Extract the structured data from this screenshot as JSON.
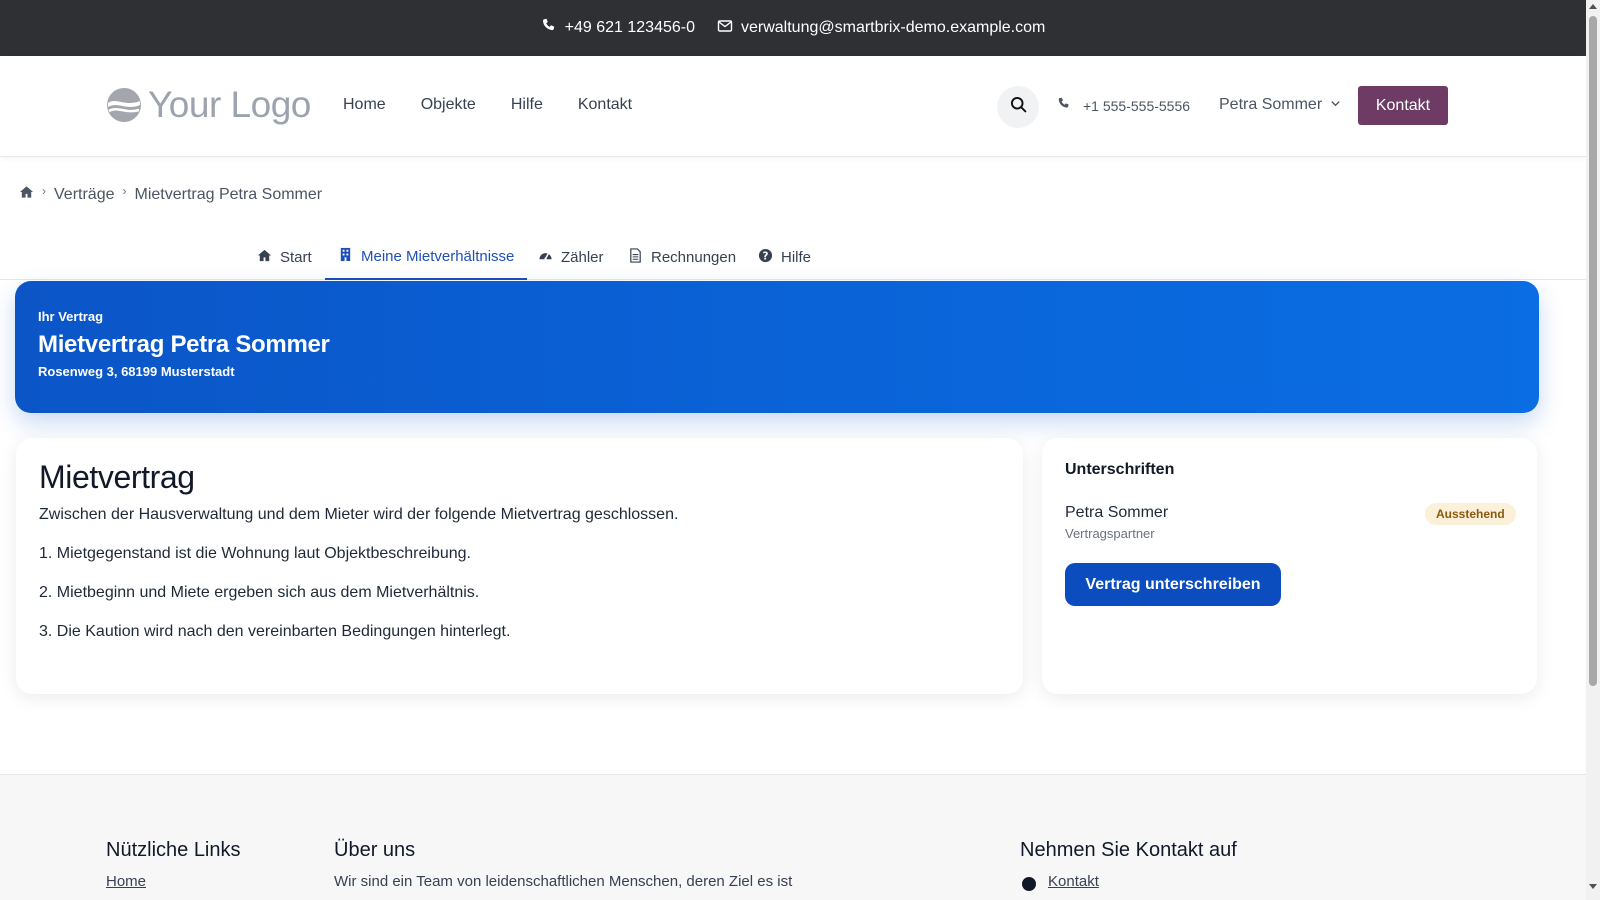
{
  "topbar": {
    "phone": "+49 621 123456-0",
    "email": "verwaltung@smartbrix-demo.example.com",
    "phone_icon": "phone-icon",
    "email_icon": "mail-icon"
  },
  "header": {
    "logo_text": "Your Logo",
    "nav": [
      "Home",
      "Objekte",
      "Hilfe",
      "Kontakt"
    ],
    "search_icon": "search-icon",
    "phone": "+1 555-555-5556",
    "user_name": "Petra Sommer",
    "cta_label": "Kontakt",
    "cta_color": "#6d3b64"
  },
  "breadcrumb": {
    "home_icon": "home-icon",
    "items": [
      "Verträge",
      "Mietvertrag Petra Sommer"
    ]
  },
  "tabs": [
    {
      "label": "Start",
      "icon": "home-icon",
      "active": false
    },
    {
      "label": "Meine Mietverhältnisse",
      "icon": "building-icon",
      "active": true
    },
    {
      "label": "Zähler",
      "icon": "gauge-icon",
      "active": false
    },
    {
      "label": "Rechnungen",
      "icon": "document-icon",
      "active": false
    },
    {
      "label": "Hilfe",
      "icon": "question-icon",
      "active": false
    }
  ],
  "hero": {
    "kicker": "Ihr Vertrag",
    "title": "Mietvertrag Petra Sommer",
    "address": "Rosenweg 3, 68199 Musterstadt",
    "color": "#0b5fd3"
  },
  "contract": {
    "title": "Mietvertrag",
    "intro": "Zwischen der Hausverwaltung und dem Mieter wird der folgende Mietvertrag geschlossen.",
    "clauses": [
      "1. Mietgegenstand ist die Wohnung laut Objektbeschreibung.",
      "2. Mietbeginn und Miete ergeben sich aus dem Mietverhältnis.",
      "3. Die Kaution wird nach den vereinbarten Bedingungen hinterlegt."
    ]
  },
  "signatures": {
    "title": "Unterschriften",
    "signer_name": "Petra Sommer",
    "signer_role": "Vertragspartner",
    "status": "Ausstehend",
    "status_color": "#fdf0d9",
    "sign_button": "Vertrag unterschreiben",
    "sign_button_color": "#0b4cbf"
  },
  "footer": {
    "col1_title": "Nützliche Links",
    "col1_first_link": "Home",
    "col2_title": "Über uns",
    "col2_text": "Wir sind ein Team von leidenschaftlichen Menschen, deren Ziel es ist",
    "col3_title": "Nehmen Sie Kontakt auf",
    "col3_first_item": "Kontakt"
  }
}
